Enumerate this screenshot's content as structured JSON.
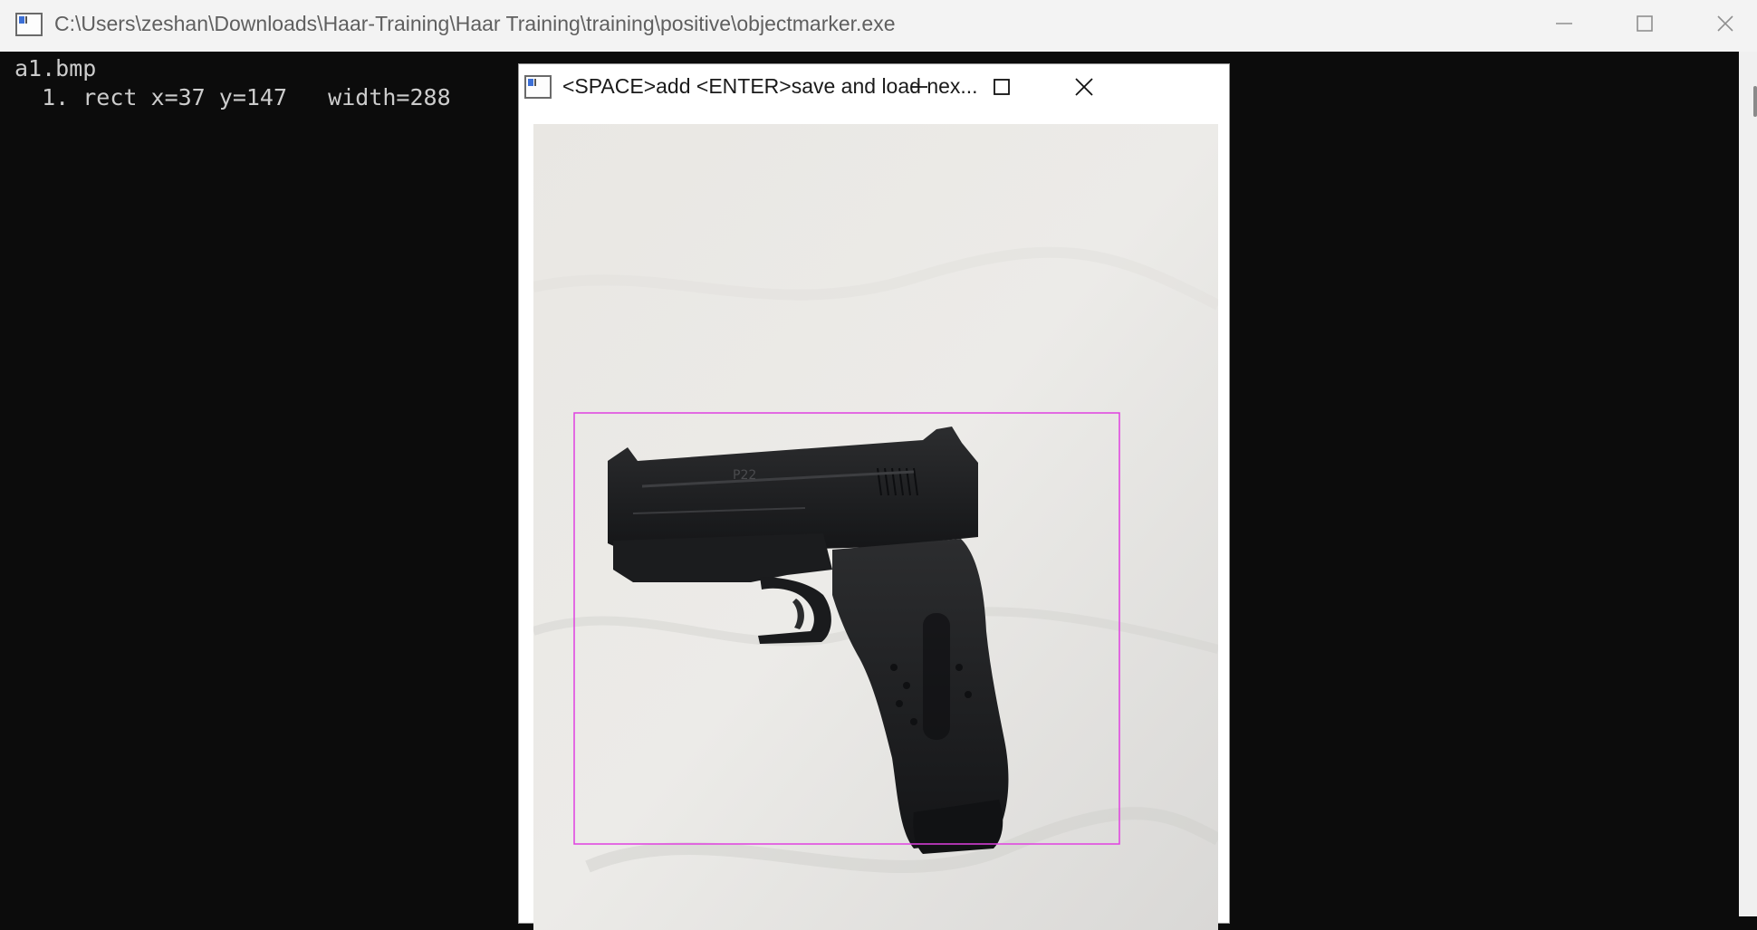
{
  "console": {
    "title": "C:\\Users\\zeshan\\Downloads\\Haar-Training\\Haar Training\\training\\positive\\objectmarker.exe",
    "lines": [
      "a1.bmp",
      "  1. rect x=37 y=147   width=288"
    ],
    "controls": {
      "minimize": "minimize-icon",
      "maximize": "maximize-icon",
      "close": "close-icon"
    }
  },
  "marker_window": {
    "title": "<SPACE>add <ENTER>save and load nex...",
    "controls": {
      "minimize": "minimize-icon",
      "maximize": "maximize-icon",
      "close": "close-icon"
    },
    "image": {
      "subject": "handgun",
      "engraving": "P22",
      "selection_color": "#e040e0"
    }
  },
  "colors": {
    "console_bg": "#0c0c0c",
    "console_text": "#cccccc",
    "titlebar_bg": "#f3f3f3",
    "selection_rect": "#e040e0"
  }
}
